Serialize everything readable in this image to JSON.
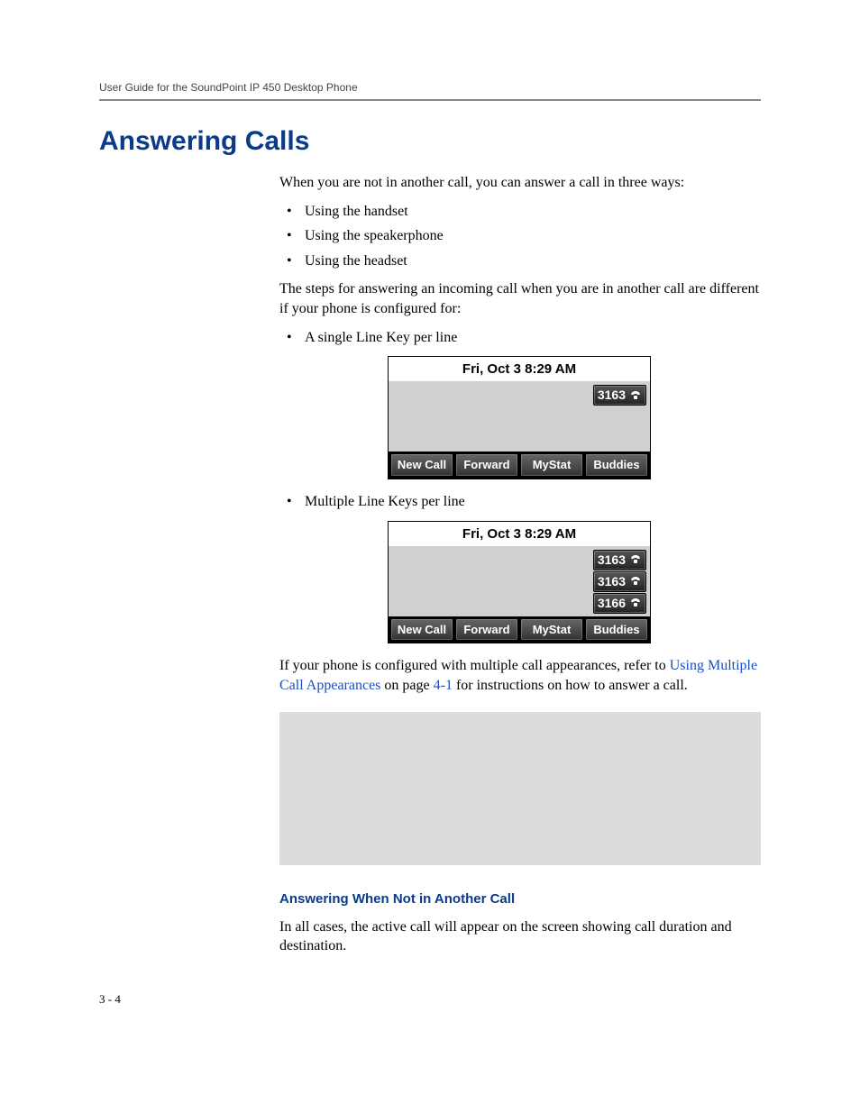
{
  "runhead": "User Guide for the SoundPoint IP 450 Desktop Phone",
  "section_title": "Answering Calls",
  "intro": "When you are not in another call, you can answer a call in three ways:",
  "ways": [
    "Using the handset",
    "Using the speakerphone",
    "Using the headset"
  ],
  "transition": "The steps for answering an incoming call when you are in another call are different if your phone is configured for:",
  "config1_label": "A single Line Key per line",
  "config2_label": "Multiple Line Keys per line",
  "screen": {
    "datetime": "Fri, Oct 3   8:29 AM",
    "softkeys": [
      "New Call",
      "Forward",
      "MyStat",
      "Buddies"
    ],
    "lines_single": [
      "3163"
    ],
    "lines_multi": [
      "3163",
      "3163",
      "3166"
    ]
  },
  "xref_para": {
    "pre": "If your phone is configured with multiple call appearances, refer to ",
    "link1": "Using Multiple Call Appearances",
    "mid": " on page ",
    "link2": "4-1",
    "post": " for instructions on how to answer a call."
  },
  "sub_title": "Answering When Not in Another Call",
  "sub_para": "In all cases, the active call will appear on the screen showing call duration and destination.",
  "page_number": "3 - 4"
}
